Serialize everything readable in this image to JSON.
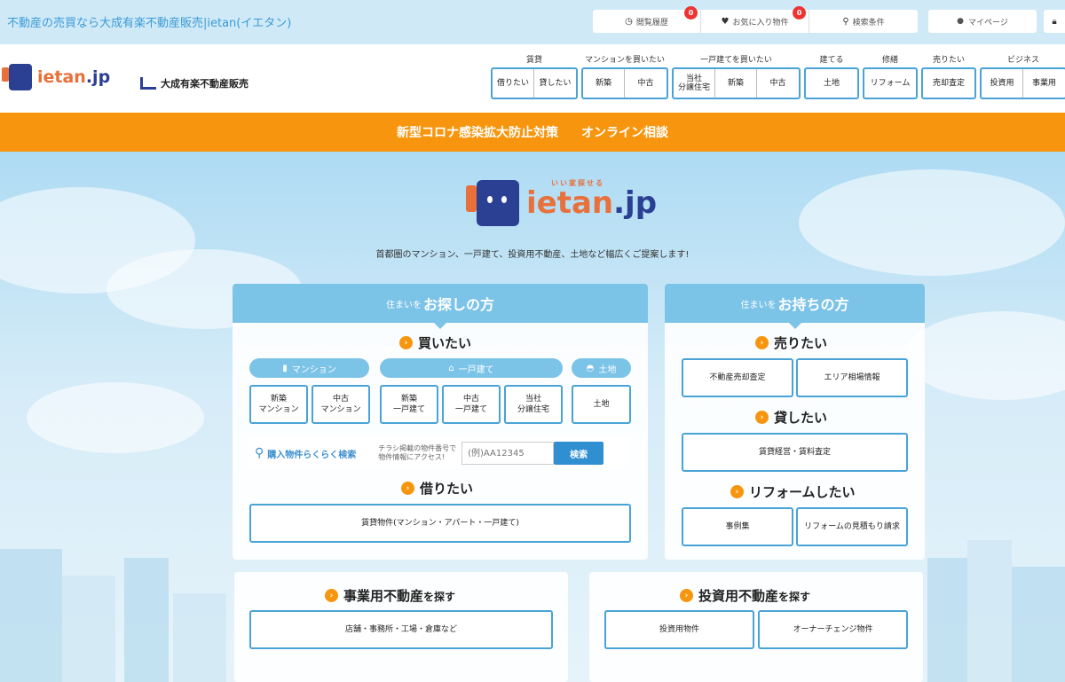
{
  "topbar": {
    "site_title": "不動産の売買なら大成有楽不動産販売|ietan(イエタン)",
    "history": "閲覧履歴",
    "history_count": "0",
    "favorites": "お気に入り物件",
    "favorites_count": "0",
    "search_conditions": "検索条件",
    "mypage": "マイページ"
  },
  "header": {
    "logo_main": "ietan",
    "logo_suffix": ".jp",
    "corp_name": "大成有楽不動産販売",
    "nav": [
      {
        "title": "賃貸",
        "items": [
          "借りたい",
          "貸したい"
        ]
      },
      {
        "title": "マンションを買いたい",
        "items": [
          "新築",
          "中古"
        ]
      },
      {
        "title": "一戸建てを買いたい",
        "items": [
          "当社\n分譲住宅",
          "新築",
          "中古"
        ]
      },
      {
        "title": "建てる",
        "items": [
          "土地"
        ]
      },
      {
        "title": "修繕",
        "items": [
          "リフォーム"
        ]
      },
      {
        "title": "売りたい",
        "items": [
          "売却査定"
        ]
      },
      {
        "title": "ビジネス",
        "items": [
          "投資用",
          "事業用"
        ]
      }
    ]
  },
  "banner": {
    "covid": "新型コロナ感染拡大防止対策",
    "online": "オンライン相談"
  },
  "hero": {
    "logo_tag": "いい家探せる",
    "logo_main": "ietan",
    "logo_suffix": ".jp",
    "tagline": "首都圏のマンション、一戸建て、投資用不動産、土地など幅広くご提案します!"
  },
  "seek": {
    "head_small": "住まいを",
    "head_big": "お探しの方",
    "buy_title": "買いたい",
    "mansion_pill": "マンション",
    "house_pill": "一戸建て",
    "land_pill": "土地",
    "buttons": {
      "new_mansion": "新築\nマンション",
      "used_mansion": "中古\nマンション",
      "new_house": "新築\n一戸建て",
      "used_house": "中古\n一戸建て",
      "own_house": "当社\n分譲住宅",
      "land": "土地"
    },
    "search_label": "購入物件らくらく検索",
    "search_note": "チラシ掲載の物件番号で\n物件情報にアクセス!",
    "search_placeholder": "(例)AA12345",
    "search_button": "検索",
    "rent_title": "借りたい",
    "rent_button": "賃貸物件(マンション・アパート・一戸建て)"
  },
  "own": {
    "head_small": "住まいを",
    "head_big": "お持ちの方",
    "sell_title": "売りたい",
    "sell_assess": "不動産売却査定",
    "area_info": "エリア相場情報",
    "lend_title": "貸したい",
    "lend_button": "賃貸経営・賃料査定",
    "reform_title": "リフォームしたい",
    "cases": "事例集",
    "estimate": "リフォームの見積もり請求"
  },
  "business": {
    "title_big": "事業用不動産",
    "title_small": "を探す",
    "button": "店舗・事務所・工場・倉庫など"
  },
  "investment": {
    "title_big": "投資用不動産",
    "title_small": "を探す",
    "button_invest": "投資用物件",
    "button_owner": "オーナーチェンジ物件"
  },
  "colors": {
    "accent_orange": "#f7960e",
    "sky_blue": "#7cc3e8",
    "border_blue": "#4aa3d6",
    "navy": "#2b3f93"
  }
}
